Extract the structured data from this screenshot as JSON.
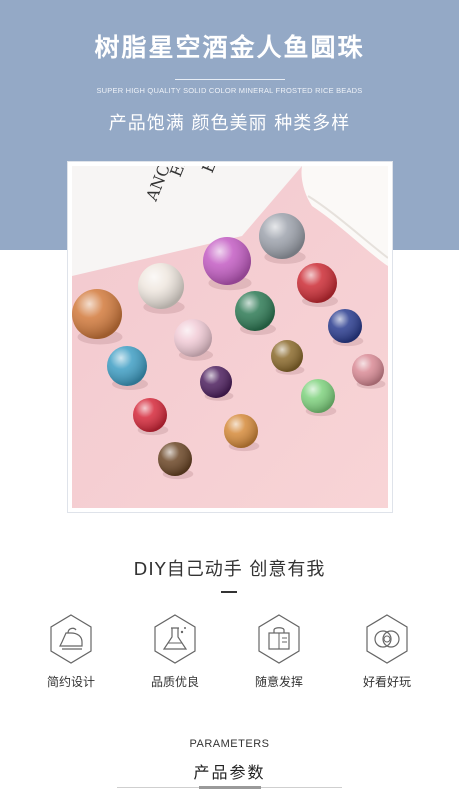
{
  "header": {
    "title": "树脂星空酒金人鱼圆珠",
    "subtitle_en": "SUPER HIGH QUALITY SOLID COLOR MINERAL FROSTED RICE BEADS",
    "subtitle_cn": "产品饱满 颜色美丽 种类多样",
    "background_color": "#94a9c6"
  },
  "photo": {
    "card_text": [
      "ED",
      "E",
      "ANCE."
    ],
    "background_color": "#f6cfd3",
    "beads": [
      {
        "name": "silver-grey",
        "color": "#9ea3ad"
      },
      {
        "name": "purple-pink",
        "color": "#c35cc3"
      },
      {
        "name": "white-pearl",
        "color": "#efe7df"
      },
      {
        "name": "orange-amber",
        "color": "#d27a3c"
      },
      {
        "name": "red-glitter",
        "color": "#cc2c35"
      },
      {
        "name": "green-glitter",
        "color": "#2e7a55"
      },
      {
        "name": "light-pink",
        "color": "#f1cbd6"
      },
      {
        "name": "navy-blue",
        "color": "#2a3c8f"
      },
      {
        "name": "cyan-blue",
        "color": "#3f9ec4"
      },
      {
        "name": "olive-gold",
        "color": "#8b6a2c"
      },
      {
        "name": "dusty-rose",
        "color": "#d98a95"
      },
      {
        "name": "deep-purple",
        "color": "#4d1f5e"
      },
      {
        "name": "mint-green",
        "color": "#7fd27e"
      },
      {
        "name": "red",
        "color": "#d5283a"
      },
      {
        "name": "caramel",
        "color": "#d58a3a"
      },
      {
        "name": "brown",
        "color": "#6b4626"
      }
    ]
  },
  "diy": {
    "title": "DIY自己动手 创意有我"
  },
  "features": [
    {
      "icon": "iron-icon",
      "label": "简约设计"
    },
    {
      "icon": "flask-icon",
      "label": "品质优良"
    },
    {
      "icon": "bag-icon",
      "label": "随意发挥"
    },
    {
      "icon": "rings-icon",
      "label": "好看好玩"
    }
  ],
  "parameters": {
    "title_en": "PARAMETERS",
    "title_cn": "产品参数"
  }
}
